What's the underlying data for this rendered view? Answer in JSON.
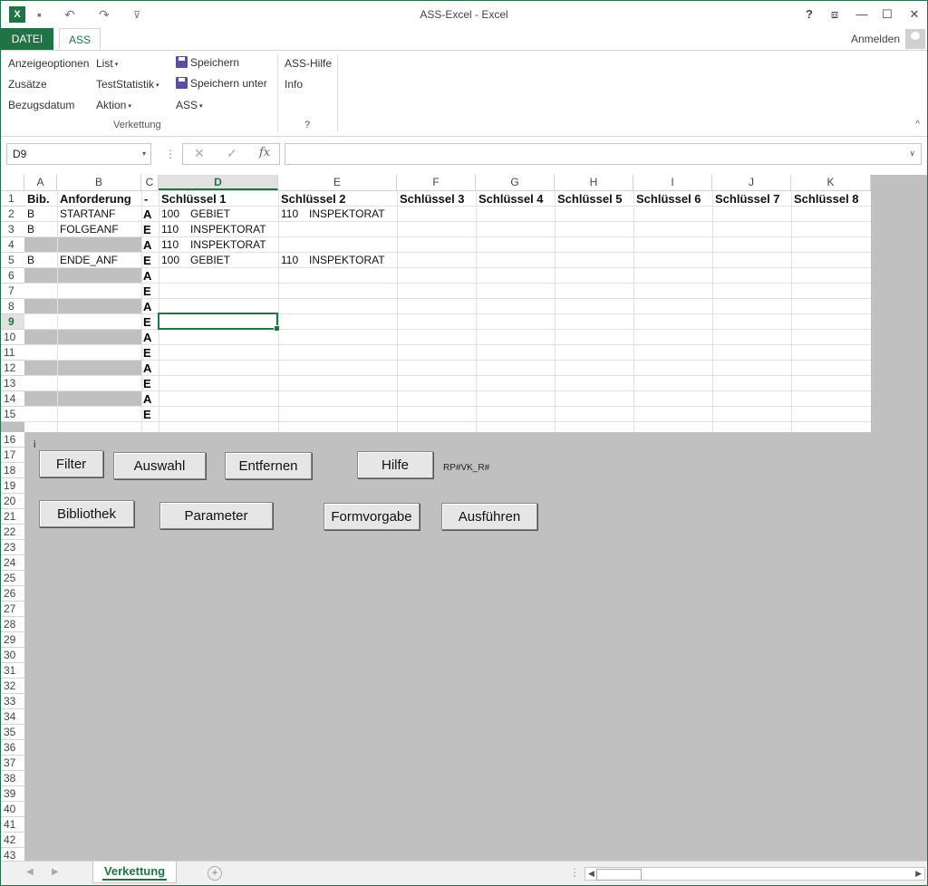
{
  "window": {
    "title": "ASS-Excel - Excel",
    "help": "?",
    "restore_ribbon": "⧈",
    "minimize": "—",
    "maximize": "☐",
    "close": "✕"
  },
  "qat": {
    "app_letter": "X",
    "save": "▪",
    "undo": "↶",
    "redo": "↷",
    "customize": "⊽"
  },
  "tabs": {
    "file": "DATEI",
    "ass": "ASS",
    "signin": "Anmelden"
  },
  "ribbon": {
    "col1": [
      "Anzeigeoptionen",
      "Zusätze",
      "Bezugsdatum"
    ],
    "col2": [
      {
        "label": "List",
        "dropdown": true
      },
      {
        "label": "TestStatistik",
        "dropdown": true
      },
      {
        "label": "Aktion",
        "dropdown": true
      }
    ],
    "col3": [
      {
        "label": "Speichern"
      },
      {
        "label": "Speichern unter"
      },
      {
        "label": "ASS",
        "dropdown": true
      }
    ],
    "group1_label": "Verkettung",
    "col4": [
      "ASS-Hilfe",
      "Info"
    ],
    "group2_label": "?",
    "dropdown_glyph": "▾",
    "collapse_glyph": "^"
  },
  "formula_bar": {
    "name_box": "D9",
    "name_dd": "▾",
    "dots": "⋮",
    "cancel": "✕",
    "enter": "✓",
    "fx": "fx",
    "formula": "",
    "formula_dd": "∨"
  },
  "columns": [
    "A",
    "B",
    "C",
    "D",
    "E",
    "F",
    "G",
    "H",
    "I",
    "J",
    "K"
  ],
  "selected_column": "D",
  "rows_all": [
    "1",
    "2",
    "3",
    "4",
    "5",
    "6",
    "7",
    "8",
    "9",
    "10",
    "11",
    "12",
    "13",
    "14",
    "15",
    "16",
    "17",
    "18",
    "19",
    "20",
    "21",
    "22",
    "23",
    "24",
    "25",
    "26",
    "27",
    "28",
    "29",
    "30",
    "31",
    "32",
    "33",
    "34",
    "35",
    "36",
    "37",
    "38",
    "39",
    "40",
    "41",
    "42",
    "43"
  ],
  "selected_row": "9",
  "headers": {
    "A": "Bib.",
    "B": "Anforderung",
    "C": "-",
    "D": "Schlüssel 1",
    "E": "Schlüssel 2",
    "F": "Schlüssel 3",
    "G": "Schlüssel 4",
    "H": "Schlüssel 5",
    "I": "Schlüssel 6",
    "J": "Schlüssel 7",
    "K": "Schlüssel 8"
  },
  "rows": [
    {
      "row": 2,
      "A": "B",
      "B": "STARTANF",
      "C": "A",
      "D_num": "100",
      "D_txt": "GEBIET",
      "E_num": "110",
      "E_txt": "INSPEKTORAT"
    },
    {
      "row": 3,
      "A": "B",
      "B": "FOLGEANF",
      "C": "E",
      "D_num": "110",
      "D_txt": "INSPEKTORAT",
      "E_num": "",
      "E_txt": ""
    },
    {
      "row": 4,
      "A": "",
      "B": "",
      "C": "A",
      "D_num": "110",
      "D_txt": "INSPEKTORAT",
      "E_num": "",
      "E_txt": ""
    },
    {
      "row": 5,
      "A": "B",
      "B": "ENDE_ANF",
      "C": "E",
      "D_num": "100",
      "D_txt": "GEBIET",
      "E_num": "110",
      "E_txt": "INSPEKTORAT"
    },
    {
      "row": 6,
      "C": "A"
    },
    {
      "row": 7,
      "C": "E"
    },
    {
      "row": 8,
      "C": "A"
    },
    {
      "row": 9,
      "C": "E"
    },
    {
      "row": 10,
      "C": "A"
    },
    {
      "row": 11,
      "C": "E"
    },
    {
      "row": 12,
      "C": "A"
    },
    {
      "row": 13,
      "C": "E"
    },
    {
      "row": 14,
      "C": "A"
    },
    {
      "row": 15,
      "C": "E"
    }
  ],
  "sheet_marker": "i",
  "buttons": {
    "filter": "Filter",
    "auswahl": "Auswahl",
    "entfernen": "Entfernen",
    "hilfe": "Hilfe",
    "bibliothek": "Bibliothek",
    "parameter": "Parameter",
    "formvorgabe": "Formvorgabe",
    "ausfuehren": "Ausführen"
  },
  "rp_label": "RP#VK_R#",
  "sheet_tabs": {
    "active": "Verkettung",
    "add": "+",
    "prev": "◀",
    "next": "▶",
    "dots": "⋮",
    "scroll_left": "◀",
    "scroll_right": "▶"
  }
}
